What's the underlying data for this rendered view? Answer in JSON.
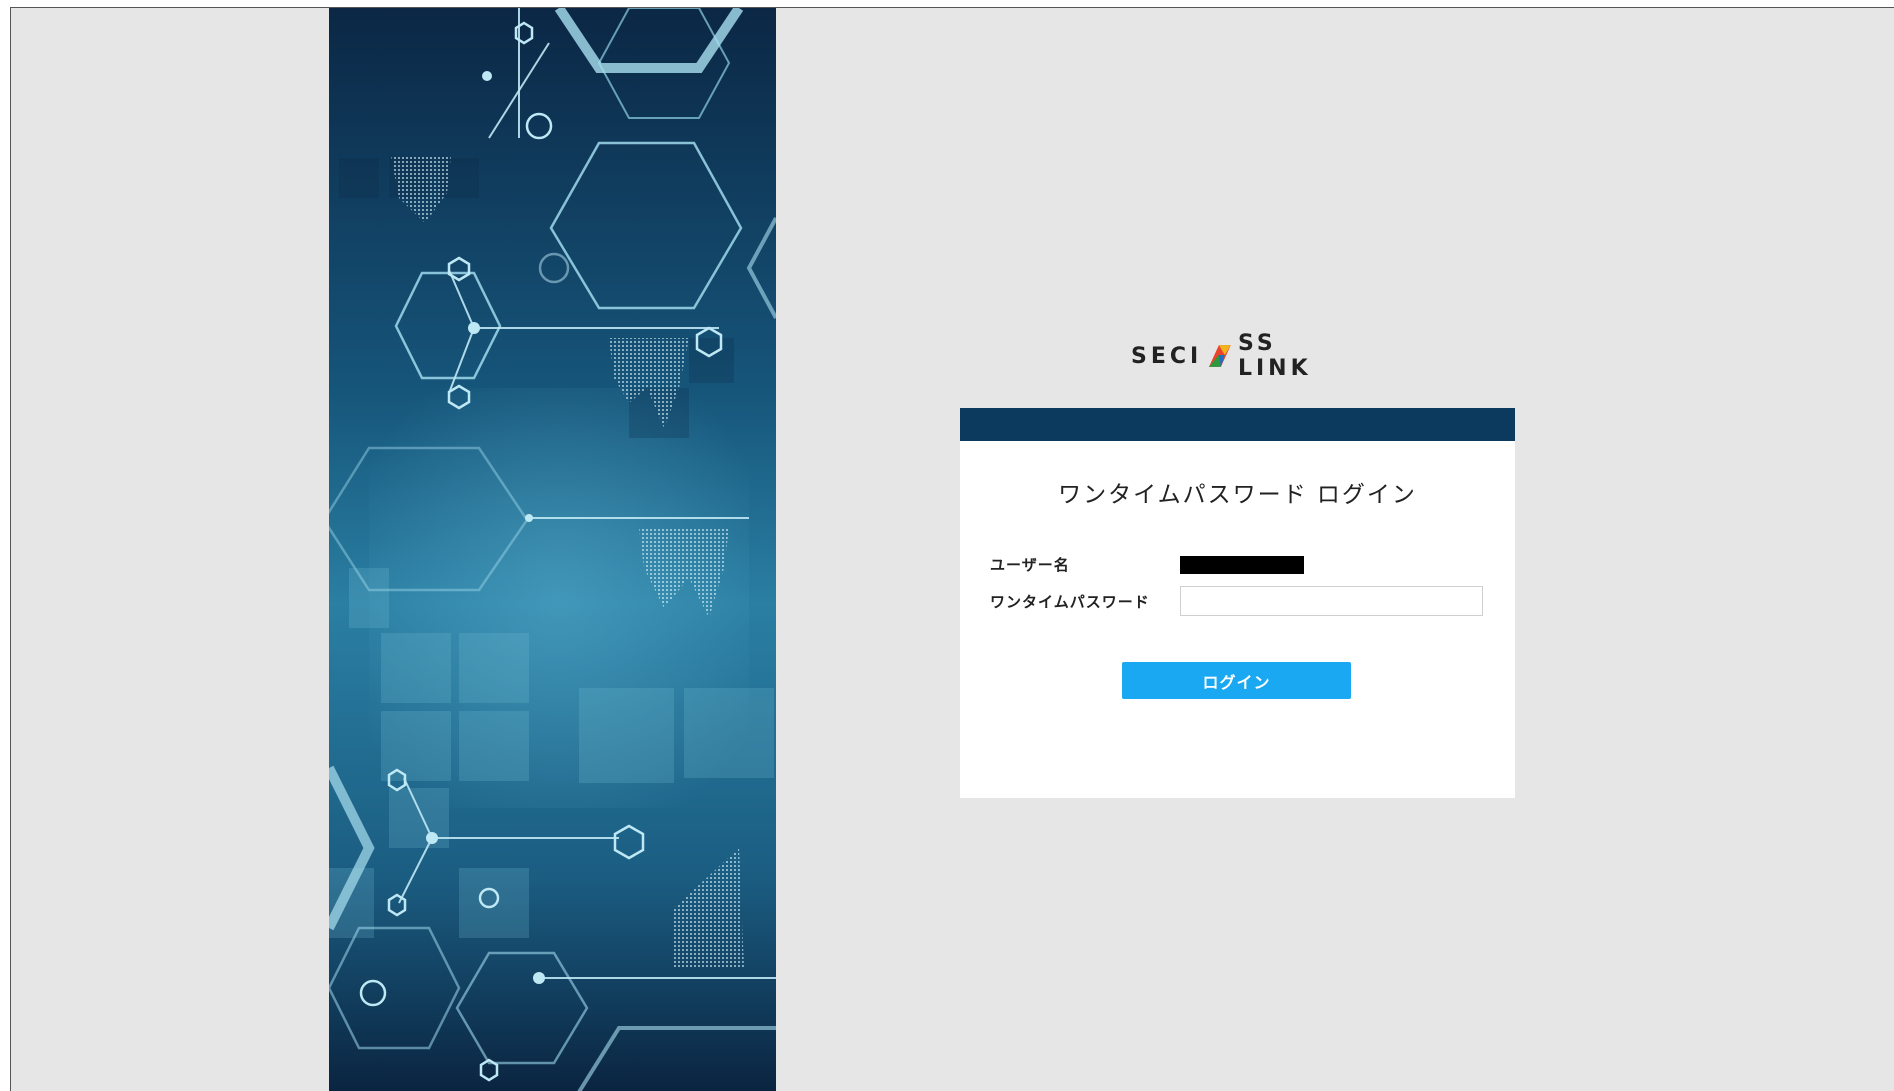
{
  "logo": {
    "text_left": "SECI",
    "text_right": "SS LINK"
  },
  "login_card": {
    "title": "ワンタイムパスワード ログイン",
    "username_label": "ユーザー名",
    "otp_label": "ワンタイムパスワード",
    "otp_value": "",
    "login_button": "ログイン"
  },
  "colors": {
    "page_background": "#e6e6e6",
    "card_header": "#0c3a5e",
    "button": "#1aa8f2",
    "banner_dark": "#0a2440",
    "banner_light": "#2a7fa3"
  }
}
